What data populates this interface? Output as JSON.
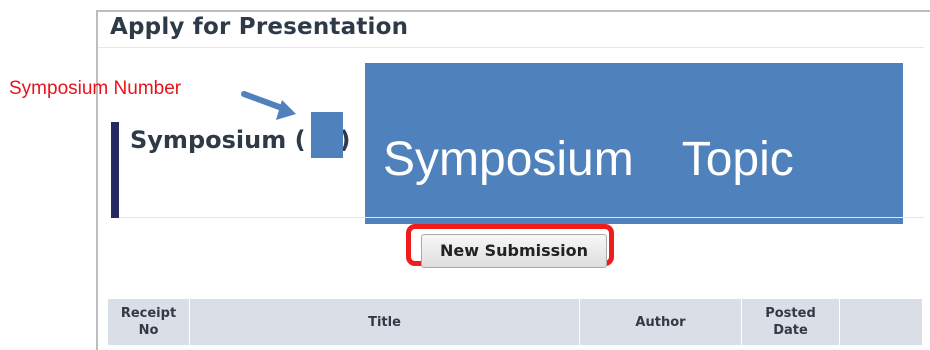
{
  "page": {
    "title": "Apply for Presentation"
  },
  "annotation": {
    "label": "Symposium Number"
  },
  "symposium": {
    "heading_prefix": "Symposium (",
    "heading_suffix": ")",
    "topic": "Symposium　Topic"
  },
  "actions": {
    "new_submission_label": "New Submission"
  },
  "table": {
    "columns": [
      "Receipt\nNo",
      "Title",
      "Author",
      "Posted\nDate",
      ""
    ]
  },
  "colors": {
    "accent_bar": "#262861",
    "placeholder_fill": "#4f81bd",
    "annotation_red": "#e8131b",
    "table_header_bg": "#d9dee7"
  }
}
